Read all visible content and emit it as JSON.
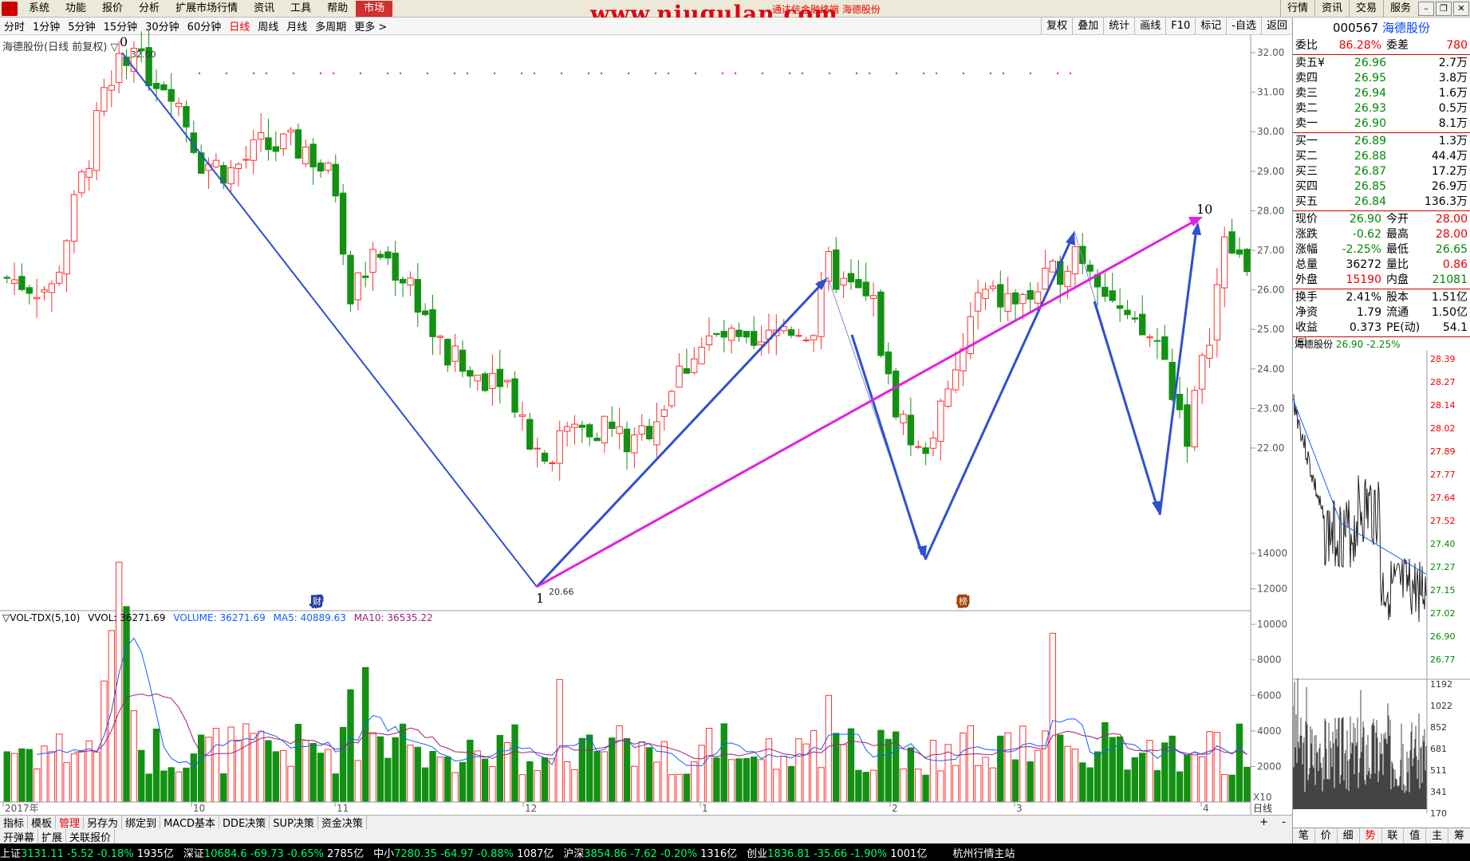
{
  "menu": {
    "items": [
      "系统",
      "功能",
      "报价",
      "分析",
      "扩展市场行情",
      "资讯",
      "工具",
      "帮助"
    ],
    "active": "市场",
    "watermark": "www.niugulan.com",
    "window_title": "通达信金融终端 海德股份",
    "right": [
      "行情",
      "资讯",
      "交易",
      "服务"
    ]
  },
  "period_bar": {
    "items": [
      "分时",
      "1分钟",
      "5分钟",
      "15分钟",
      "30分钟",
      "60分钟",
      "日线",
      "周线",
      "月线",
      "多周期",
      "更多 >"
    ],
    "selected": "日线",
    "tools": [
      "复权",
      "叠加",
      "统计",
      "画线",
      "F10",
      "标记",
      "-自选",
      "返回"
    ]
  },
  "chart": {
    "title": "海德股份(日线 前复权) ▽",
    "price_ticks": [
      "32.00",
      "31.00",
      "30.00",
      "29.00",
      "28.00",
      "27.00",
      "26.00",
      "25.00",
      "24.00",
      "23.00",
      "22.00"
    ],
    "high_label": "32.00",
    "low_label": "20.66",
    "wave_labels": [
      "0",
      "1",
      "10"
    ],
    "month_labels": [
      "2017年",
      "10",
      "11",
      "12",
      "1",
      "2",
      "3",
      "4"
    ],
    "volume_ticks": [
      "14000",
      "12000",
      "10000",
      "8000",
      "6000",
      "4000",
      "2000"
    ],
    "vol_unit": "X10",
    "period_name": "日线",
    "tags": [
      "财",
      "榜"
    ]
  },
  "vol_legend": {
    "name": "▽VOL-TDX(5,10)",
    "vvol": "VVOL: 36271.69",
    "volume": "VOLUME: 36271.69",
    "ma5": "MA5: 40889.63",
    "ma10": "MA10: 36535.22"
  },
  "bottom_tabs": [
    "指标",
    "模板",
    "管理",
    "另存为",
    "绑定到",
    "MACD基本",
    "DDE决策",
    "SUP决策",
    "资金决策"
  ],
  "bottom_tabs_selected": "管理",
  "bottom_tabs2": [
    "开弹幕",
    "扩展",
    "关联报价"
  ],
  "status": [
    {
      "name": "上证",
      "val": "3131.11",
      "chg": "-5.52",
      "pct": "-0.18%",
      "amt": "1935亿"
    },
    {
      "name": "深证",
      "val": "10684.6",
      "chg": "-69.73",
      "pct": "-0.65%",
      "amt": "2785亿"
    },
    {
      "name": "中小",
      "val": "7280.35",
      "chg": "-64.97",
      "pct": "-0.88%",
      "amt": "1087亿"
    },
    {
      "name": "沪深",
      "val": "3854.86",
      "chg": "-7.62",
      "pct": "-0.20%",
      "amt": "1316亿"
    },
    {
      "name": "创业",
      "val": "1836.81",
      "chg": "-35.66",
      "pct": "-1.90%",
      "amt": "1001亿"
    }
  ],
  "status_right": "杭州行情主站",
  "quote": {
    "code": "000567",
    "name": "海德股份",
    "weibi_label": "委比",
    "weibi": "86.28%",
    "weicha_label": "委差",
    "weicha": "780",
    "sells": [
      {
        "label": "卖五¥",
        "price": "26.96",
        "vol": "2.7万"
      },
      {
        "label": "卖四",
        "price": "26.95",
        "vol": "3.8万"
      },
      {
        "label": "卖三",
        "price": "26.94",
        "vol": "1.6万"
      },
      {
        "label": "卖二",
        "price": "26.93",
        "vol": "0.5万"
      },
      {
        "label": "卖一",
        "price": "26.90",
        "vol": "8.1万"
      }
    ],
    "buys": [
      {
        "label": "买一",
        "price": "26.89",
        "vol": "1.3万"
      },
      {
        "label": "买二",
        "price": "26.88",
        "vol": "44.4万"
      },
      {
        "label": "买三",
        "price": "26.87",
        "vol": "17.2万"
      },
      {
        "label": "买四",
        "price": "26.85",
        "vol": "26.9万"
      },
      {
        "label": "买五",
        "price": "26.84",
        "vol": "136.3万"
      }
    ],
    "stats": [
      {
        "a": "现价",
        "b": "26.90",
        "c": "今开",
        "d": "28.00",
        "bc": "grn",
        "dc": "red"
      },
      {
        "a": "涨跌",
        "b": "-0.62",
        "c": "最高",
        "d": "28.00",
        "bc": "grn",
        "dc": "red"
      },
      {
        "a": "涨幅",
        "b": "-2.25%",
        "c": "最低",
        "d": "26.65",
        "bc": "grn",
        "dc": "grn"
      },
      {
        "a": "总量",
        "b": "36272",
        "c": "量比",
        "d": "0.86",
        "bc": "",
        "dc": "red"
      },
      {
        "a": "外盘",
        "b": "15190",
        "c": "内盘",
        "d": "21081",
        "bc": "red",
        "dc": "grn"
      }
    ],
    "stats2": [
      {
        "a": "换手",
        "b": "2.41%",
        "c": "股本",
        "d": "1.51亿"
      },
      {
        "a": "净资",
        "b": "1.79",
        "c": "流通",
        "d": "1.50亿"
      },
      {
        "a": "收益㈢",
        "b": "0.373",
        "c": "PE(动)",
        "d": "54.1"
      }
    ],
    "mini_title": "海德股份",
    "mini_price": "26.90",
    "mini_pct": "-2.25%",
    "mini_ticks": [
      "28.39",
      "28.27",
      "28.14",
      "28.02",
      "27.89",
      "27.77",
      "27.64",
      "27.52",
      "27.40",
      "27.27",
      "27.15",
      "27.02",
      "26.90",
      "26.77"
    ],
    "mini_vol_ticks": [
      "1192",
      "1022",
      "852",
      "681",
      "511",
      "341",
      "170"
    ],
    "side_tabs": [
      "笔",
      "价",
      "细",
      "势",
      "联",
      "值",
      "主",
      "筹"
    ],
    "side_tab_selected": "势"
  },
  "chart_data": {
    "type": "candlestick",
    "title": "",
    "xlabel": "",
    "ylabel": "",
    "ylim": [
      20.0,
      32.2
    ],
    "points": [
      {
        "label": "0",
        "price": 32.0
      },
      {
        "label": "1",
        "price": 20.66
      },
      {
        "label": "10",
        "price": 28.4
      }
    ]
  }
}
